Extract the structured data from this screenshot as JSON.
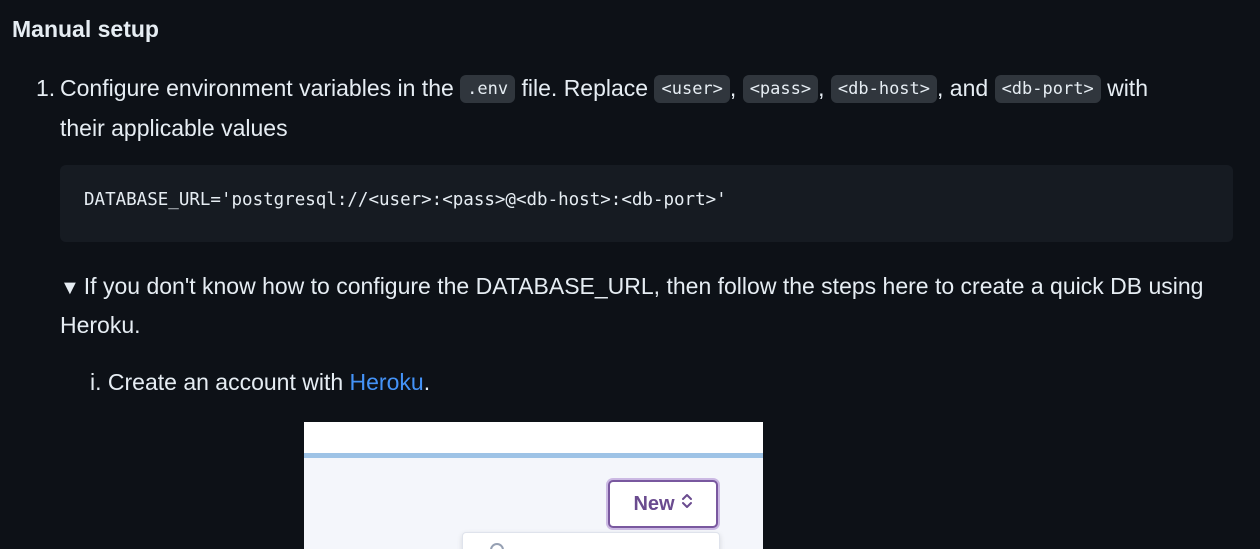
{
  "section": {
    "heading": "Manual setup"
  },
  "step1": {
    "number": "1.",
    "text_a": "Configure environment variables in the ",
    "code_env": ".env",
    "text_b": " file. Replace ",
    "code_user": "<user>",
    "sep1": ", ",
    "code_pass": "<pass>",
    "sep2": ", ",
    "code_host": "<db-host>",
    "sep3": ", and ",
    "code_port": "<db-port>",
    "text_c": " with",
    "line2": "their applicable values"
  },
  "code_block": {
    "content": "DATABASE_URL='postgresql://<user>:<pass>@<db-host>:<db-port>'"
  },
  "details": {
    "triangle": "▼",
    "summary": "If you don't know how to configure the DATABASE_URL, then follow the steps here to create a quick DB using Heroku."
  },
  "sub_step": {
    "number": "i.",
    "text_a": "Create an account with ",
    "link": "Heroku",
    "text_b": "."
  },
  "screenshot": {
    "new_button_label": "New",
    "new_button_icon": "chevron-updown-icon",
    "accent_color": "#79589f"
  }
}
